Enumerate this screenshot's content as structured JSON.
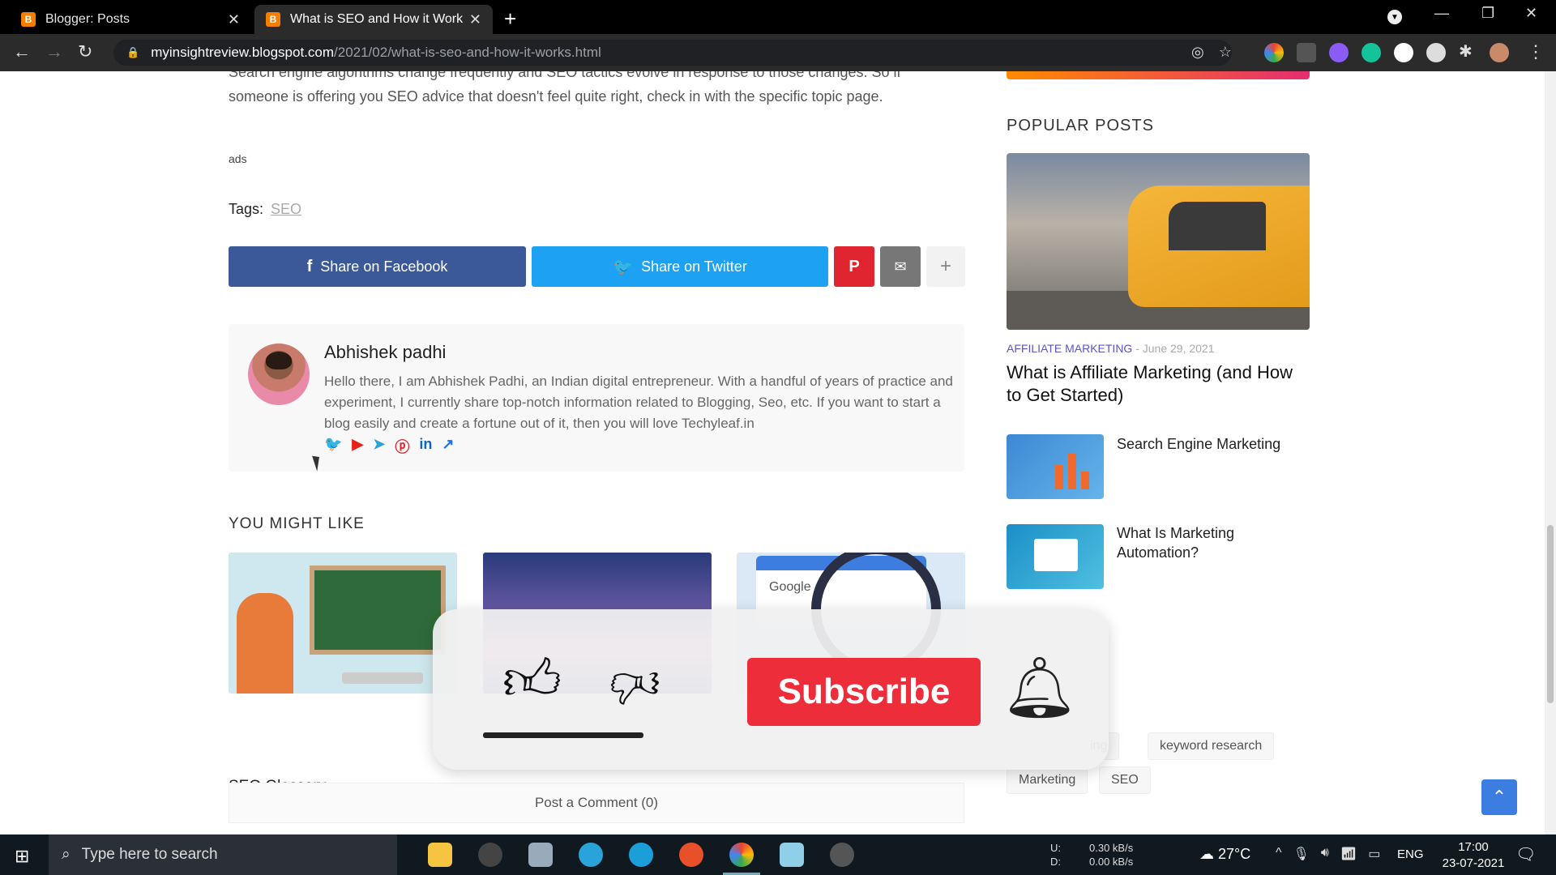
{
  "browser": {
    "tabs": [
      {
        "title": "Blogger: Posts",
        "active": false
      },
      {
        "title": "What is SEO and How it Works?",
        "active": true
      }
    ],
    "url": {
      "host": "myinsightreview.blogspot.com",
      "path": "/2021/02/what-is-seo-and-how-it-works.html"
    }
  },
  "article": {
    "text": "Search engine algorithms change frequently and SEO tactics evolve in response to those changes. So if someone is offering you SEO advice that doesn't feel quite right, check in with the specific topic page.",
    "ads_label": "ads",
    "tags_label": "Tags:",
    "tag": "SEO"
  },
  "share": {
    "facebook": "Share on Facebook",
    "twitter": "Share on Twitter",
    "pinterest_glyph": "P",
    "mail_glyph": "✉",
    "more_glyph": "+"
  },
  "author": {
    "name": "Abhishek padhi",
    "bio": "Hello there, I am Abhishek Padhi, an Indian digital entrepreneur. With a handful of years of practice and experiment, I currently share top-notch information related to Blogging, Seo, etc. If you want to start a blog easily and create a fortune out of it, then you will love Techyleaf.in",
    "socials": [
      "twitter-icon",
      "youtube-icon",
      "telegram-icon",
      "pinterest-icon",
      "linkedin-icon",
      "external-link-icon"
    ]
  },
  "related": {
    "heading": "YOU MIGHT LIKE",
    "cards": [
      {
        "title": "SEO Glossary"
      },
      {
        "title": ""
      },
      {
        "title": "",
        "image_text": "Google"
      }
    ],
    "post_comment": "Post a Comment (0)"
  },
  "sidebar": {
    "heading": "POPULAR POSTS",
    "featured": {
      "category": "AFFILIATE MARKETING",
      "date": " - June 29, 2021",
      "title": "What is Affiliate Marketing (and How to Get Started)"
    },
    "posts": [
      {
        "title": "Search Engine Marketing"
      },
      {
        "title": "What Is Marketing Automation?"
      }
    ],
    "labels": [
      "ing",
      "keyword research",
      "Marketing",
      "SEO"
    ]
  },
  "overlay": {
    "subscribe": "Subscribe"
  },
  "taskbar": {
    "search_placeholder": "Type here to search",
    "net_up_label": "U:",
    "net_down_label": "D:",
    "net_up": "0.30 kB/s",
    "net_down": "0.00 kB/s",
    "temperature": "27°C",
    "language": "ENG",
    "time": "17:00",
    "date": "23-07-2021"
  },
  "colors": {
    "facebook": "#3b5998",
    "twitter": "#1da1f2",
    "pinterest": "#e02530",
    "subscribe": "#ee2d3b",
    "category": "#5a55c8"
  }
}
